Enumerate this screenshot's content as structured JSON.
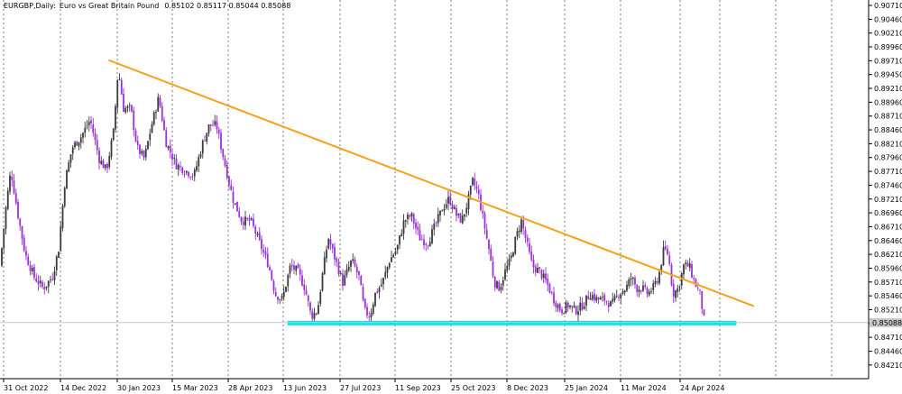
{
  "header": {
    "symbol": "EURGBP,Daily:",
    "description": "Euro vs Great Britain Pound",
    "ohlc": "0.85102 0.85117 0.85044 0.85088"
  },
  "colors": {
    "background": "#ffffff",
    "grid": "#5a5a5a",
    "axis": "#000000",
    "bull_candle": "#3a3a3a",
    "bear_candle": "#9b30d6",
    "resistance_line": "#f5a21a",
    "support_zone": "#00e5ee",
    "current_price_tag": "#c8c8c8"
  },
  "chart_data": {
    "type": "candlestick",
    "symbol": "EURGBP",
    "timeframe": "Daily",
    "ylim": [
      0.8409,
      0.9083
    ],
    "y_ticks": [
      "0.90710",
      "0.90460",
      "0.90210",
      "0.89960",
      "0.89710",
      "0.89450",
      "0.89210",
      "0.88960",
      "0.88710",
      "0.88460",
      "0.88210",
      "0.87960",
      "0.87710",
      "0.87460",
      "0.87210",
      "0.86960",
      "0.86710",
      "0.86460",
      "0.86210",
      "0.85960",
      "0.85710",
      "0.85460",
      "0.85210",
      "0.84960",
      "0.84710",
      "0.84460",
      "0.84210"
    ],
    "x_ticks": [
      "31 Oct 2022",
      "14 Dec 2022",
      "30 Jan 2023",
      "15 Mar 2023",
      "28 Apr 2023",
      "13 Jun 2023",
      "27 Jul 2023",
      "11 Sep 2023",
      "25 Oct 2023",
      "8 Dec 2023",
      "25 Jan 2024",
      "11 Mar 2024",
      "24 Apr 2024"
    ],
    "current_price": "0.85088",
    "price_path": [
      [
        0,
        0.861
      ],
      [
        7,
        0.872
      ],
      [
        12,
        0.878
      ],
      [
        20,
        0.87
      ],
      [
        28,
        0.863
      ],
      [
        38,
        0.859
      ],
      [
        48,
        0.857
      ],
      [
        58,
        0.859
      ],
      [
        65,
        0.864
      ],
      [
        72,
        0.876
      ],
      [
        80,
        0.882
      ],
      [
        90,
        0.884
      ],
      [
        100,
        0.887
      ],
      [
        110,
        0.88
      ],
      [
        118,
        0.878
      ],
      [
        126,
        0.885
      ],
      [
        131,
        0.896
      ],
      [
        137,
        0.889
      ],
      [
        145,
        0.889
      ],
      [
        152,
        0.882
      ],
      [
        160,
        0.88
      ],
      [
        168,
        0.886
      ],
      [
        176,
        0.891
      ],
      [
        184,
        0.883
      ],
      [
        195,
        0.879
      ],
      [
        205,
        0.878
      ],
      [
        215,
        0.877
      ],
      [
        225,
        0.883
      ],
      [
        232,
        0.886
      ],
      [
        240,
        0.886
      ],
      [
        248,
        0.88
      ],
      [
        258,
        0.873
      ],
      [
        268,
        0.869
      ],
      [
        278,
        0.869
      ],
      [
        288,
        0.865
      ],
      [
        298,
        0.861
      ],
      [
        305,
        0.856
      ],
      [
        313,
        0.855
      ],
      [
        322,
        0.861
      ],
      [
        330,
        0.86
      ],
      [
        338,
        0.857
      ],
      [
        345,
        0.852
      ],
      [
        352,
        0.853
      ],
      [
        358,
        0.86
      ],
      [
        364,
        0.866
      ],
      [
        372,
        0.862
      ],
      [
        380,
        0.858
      ],
      [
        390,
        0.862
      ],
      [
        398,
        0.859
      ],
      [
        404,
        0.853
      ],
      [
        410,
        0.852
      ],
      [
        416,
        0.856
      ],
      [
        424,
        0.858
      ],
      [
        432,
        0.862
      ],
      [
        440,
        0.864
      ],
      [
        448,
        0.869
      ],
      [
        456,
        0.87
      ],
      [
        465,
        0.866
      ],
      [
        474,
        0.865
      ],
      [
        482,
        0.868
      ],
      [
        490,
        0.871
      ],
      [
        498,
        0.873
      ],
      [
        506,
        0.87
      ],
      [
        512,
        0.869
      ],
      [
        518,
        0.872
      ],
      [
        524,
        0.876
      ],
      [
        530,
        0.874
      ],
      [
        536,
        0.869
      ],
      [
        542,
        0.864
      ],
      [
        548,
        0.858
      ],
      [
        554,
        0.857
      ],
      [
        560,
        0.86
      ],
      [
        566,
        0.862
      ],
      [
        572,
        0.866
      ],
      [
        578,
        0.869
      ],
      [
        584,
        0.865
      ],
      [
        590,
        0.861
      ],
      [
        598,
        0.86
      ],
      [
        606,
        0.858
      ],
      [
        614,
        0.855
      ],
      [
        622,
        0.853
      ],
      [
        630,
        0.854
      ],
      [
        638,
        0.853
      ],
      [
        646,
        0.854
      ],
      [
        654,
        0.856
      ],
      [
        662,
        0.855
      ],
      [
        670,
        0.855
      ],
      [
        678,
        0.854
      ],
      [
        686,
        0.856
      ],
      [
        694,
        0.857
      ],
      [
        700,
        0.859
      ],
      [
        706,
        0.857
      ],
      [
        712,
        0.857
      ],
      [
        718,
        0.856
      ],
      [
        724,
        0.857
      ],
      [
        730,
        0.859
      ],
      [
        736,
        0.864
      ],
      [
        741,
        0.863
      ],
      [
        746,
        0.856
      ],
      [
        752,
        0.857
      ],
      [
        758,
        0.861
      ],
      [
        764,
        0.861
      ],
      [
        770,
        0.858
      ],
      [
        776,
        0.856
      ],
      [
        781,
        0.8509
      ]
    ],
    "annotations": [
      {
        "type": "trendline",
        "name": "descending resistance",
        "from": {
          "date": "23 Jan 2023",
          "price": 0.8976
        },
        "to": {
          "date": "22 Jun 2024",
          "price": 0.8538
        }
      },
      {
        "type": "support_zone",
        "name": "horizontal support",
        "price_low": 0.8504,
        "price_high": 0.8512,
        "from": "15 Jun 2023",
        "to": "8 Jun 2024"
      }
    ],
    "grid": {
      "vertical": true,
      "horizontal": false
    }
  }
}
